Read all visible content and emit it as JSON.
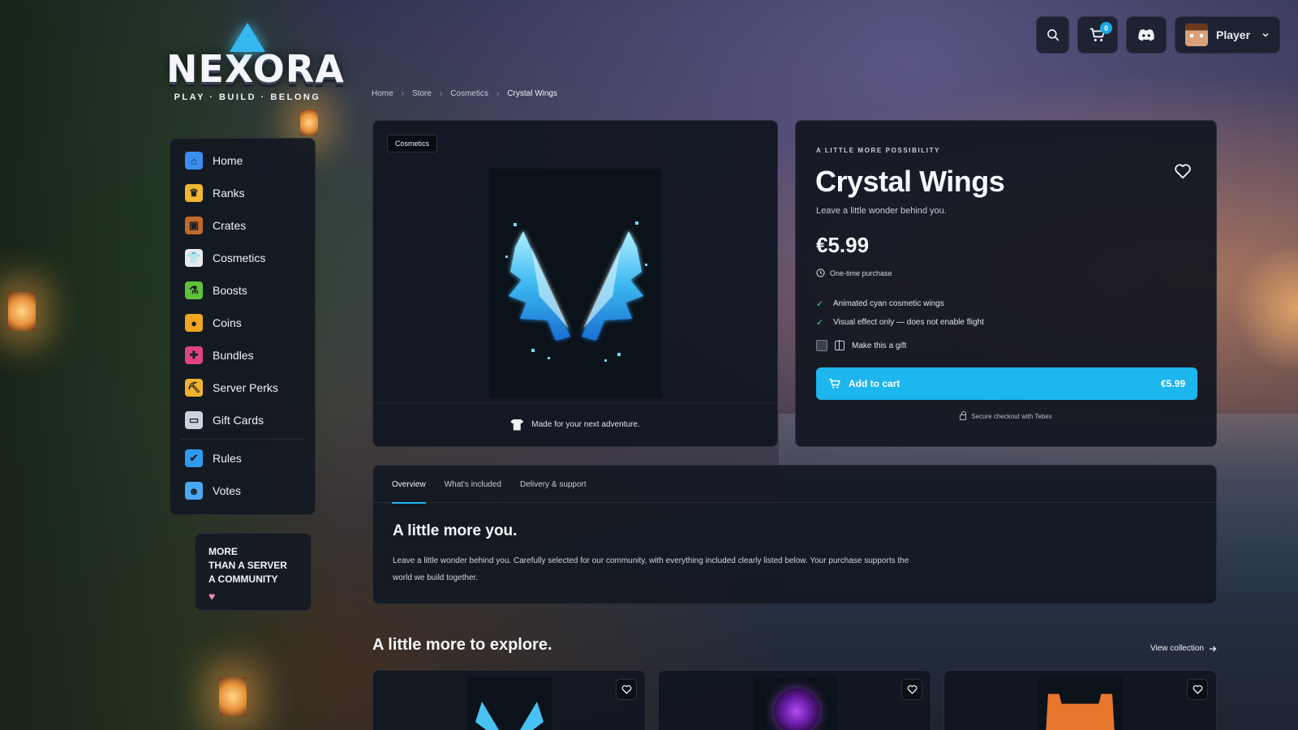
{
  "brand": {
    "name": "NEXORA",
    "tagline": "PLAY · BUILD · BELONG"
  },
  "topbar": {
    "cart_count": "0",
    "user_name": "Player"
  },
  "sidebar": {
    "items": [
      {
        "label": "Home",
        "icon": "home-icon",
        "color": "#3b8ef0"
      },
      {
        "label": "Ranks",
        "icon": "crown-icon",
        "color": "#f2b632"
      },
      {
        "label": "Crates",
        "icon": "chest-icon",
        "color": "#c26a2a"
      },
      {
        "label": "Cosmetics",
        "icon": "shirt-icon",
        "color": "#e8e8ea"
      },
      {
        "label": "Boosts",
        "icon": "potion-icon",
        "color": "#5fc23a"
      },
      {
        "label": "Coins",
        "icon": "coin-icon",
        "color": "#f2a51f"
      },
      {
        "label": "Bundles",
        "icon": "gift-icon",
        "color": "#e0447c"
      },
      {
        "label": "Server Perks",
        "icon": "pickaxe-icon",
        "color": "#f0b22c"
      },
      {
        "label": "Gift Cards",
        "icon": "giftcard-icon",
        "color": "#c9d3de"
      }
    ],
    "secondary_items": [
      {
        "label": "Rules",
        "icon": "shield-icon",
        "color": "#2f9bf0"
      },
      {
        "label": "Votes",
        "icon": "people-icon",
        "color": "#4aa8f2"
      }
    ],
    "community": {
      "line1": "MORE",
      "line2": "THAN A SERVER",
      "line3": "A COMMUNITY"
    }
  },
  "breadcrumb": [
    "Home",
    "Store",
    "Cosmetics",
    "Crystal Wings"
  ],
  "product": {
    "category": "Cosmetics",
    "image_caption": "Made for your next adventure.",
    "eyebrow": "A LITTLE MORE POSSIBILITY",
    "title": "Crystal Wings",
    "subtitle": "Leave a little wonder behind you.",
    "price": "€5.99",
    "purchase_type": "One-time purchase",
    "features": [
      "Animated cyan cosmetic wings",
      "Visual effect only — does not enable flight"
    ],
    "gift_label": "Make this a gift",
    "add_to_cart_label": "Add to cart",
    "add_to_cart_price": "€5.99",
    "secure_note": "Secure checkout with Tebex",
    "accent_color": "#1db6ef"
  },
  "tabs": {
    "items": [
      "Overview",
      "What's included",
      "Delivery & support"
    ],
    "active": "Overview",
    "heading": "A little more you.",
    "body": "Leave a little wonder behind you. Carefully selected for our community, with everything included clearly listed below. Your purchase supports the world we build together."
  },
  "explore": {
    "title": "A little more to explore.",
    "view_link": "View collection"
  }
}
